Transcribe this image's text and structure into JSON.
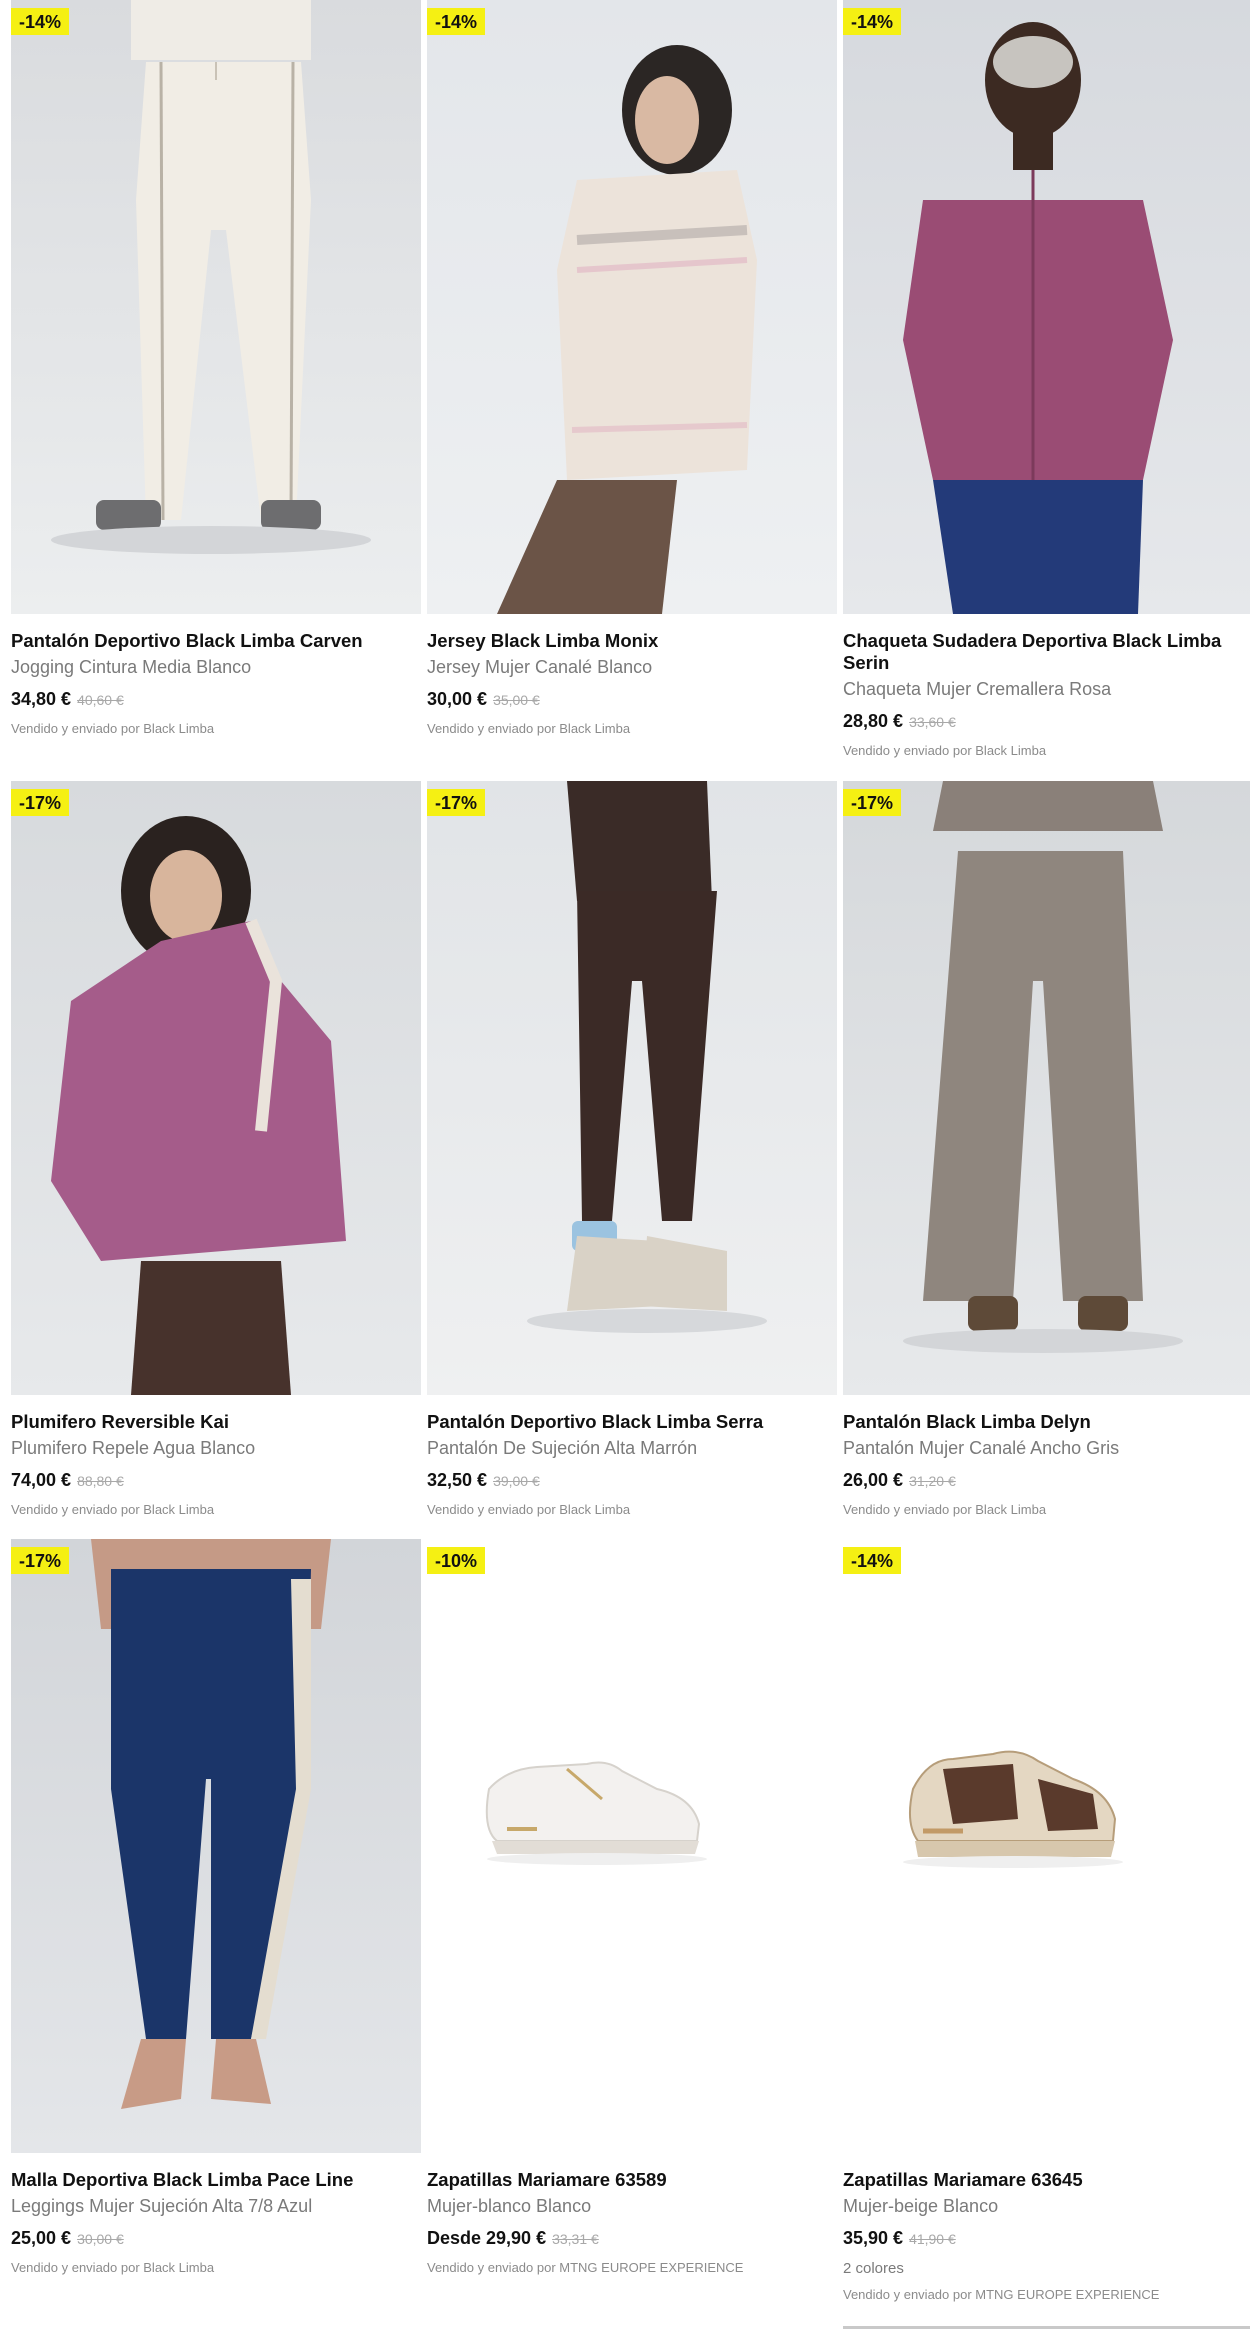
{
  "products": [
    {
      "badge": "-14%",
      "title": "Pantalón Deportivo Black Limba Carven",
      "subtitle": "Jogging Cintura Media Blanco",
      "price": "34,80 €",
      "old_price": "40,60 €",
      "seller": "Vendido y enviado por Black Limba",
      "image": "cream-jogging-pants-photo"
    },
    {
      "badge": "-14%",
      "title": "Jersey Black Limba Monix",
      "subtitle": "Jersey Mujer Canalé Blanco",
      "price": "30,00 €",
      "old_price": "35,00 €",
      "seller": "Vendido y enviado por Black Limba",
      "image": "fairisle-sweater-photo"
    },
    {
      "badge": "-14%",
      "title": "Chaqueta Sudadera Deportiva Black Limba Serin",
      "subtitle": "Chaqueta Mujer Cremallera Rosa",
      "price": "28,80 €",
      "old_price": "33,60 €",
      "seller": "Vendido y enviado por Black Limba",
      "image": "pink-zip-jacket-photo"
    },
    {
      "badge": "-17%",
      "title": "Plumifero Reversible Kai",
      "subtitle": "Plumifero Repele Agua Blanco",
      "price": "74,00 €",
      "old_price": "88,80 €",
      "seller": "Vendido y enviado por Black Limba",
      "image": "pink-puffer-jacket-photo"
    },
    {
      "badge": "-17%",
      "title": "Pantalón Deportivo Black Limba Serra",
      "subtitle": "Pantalón De Sujeción Alta Marrón",
      "price": "32,50 €",
      "old_price": "39,00 €",
      "seller": "Vendido y enviado por Black Limba",
      "image": "brown-leggings-photo"
    },
    {
      "badge": "-17%",
      "title": "Pantalón Black Limba Delyn",
      "subtitle": "Pantalón Mujer Canalé Ancho Gris",
      "price": "26,00 €",
      "old_price": "31,20 €",
      "seller": "Vendido y enviado por Black Limba",
      "image": "grey-wide-pants-photo"
    },
    {
      "badge": "-17%",
      "title": "Malla Deportiva Black Limba Pace Line",
      "subtitle": "Leggings Mujer Sujeción Alta 7/8 Azul",
      "price": "25,00 €",
      "old_price": "30,00 €",
      "seller": "Vendido y enviado por Black Limba",
      "image": "navy-leggings-photo"
    },
    {
      "badge": "-10%",
      "title": "Zapatillas Mariamare 63589",
      "subtitle": "Mujer-blanco Blanco",
      "price": "Desde 29,90 €",
      "old_price": "33,31 €",
      "seller": "Vendido y enviado por MTNG EUROPE EXPERIENCE",
      "image": "white-sneaker-photo"
    },
    {
      "badge": "-14%",
      "title": "Zapatillas Mariamare 63645",
      "subtitle": "Mujer-beige Blanco",
      "price": "35,90 €",
      "old_price": "41,90 €",
      "colors": "2 colores",
      "seller": "Vendido y enviado por MTNG EUROPE EXPERIENCE",
      "image": "beige-sneaker-photo"
    }
  ],
  "colors": {
    "badge_bg": "#f5f013",
    "subtitle": "#7a7a7a",
    "old_price": "#a8a8a8"
  }
}
